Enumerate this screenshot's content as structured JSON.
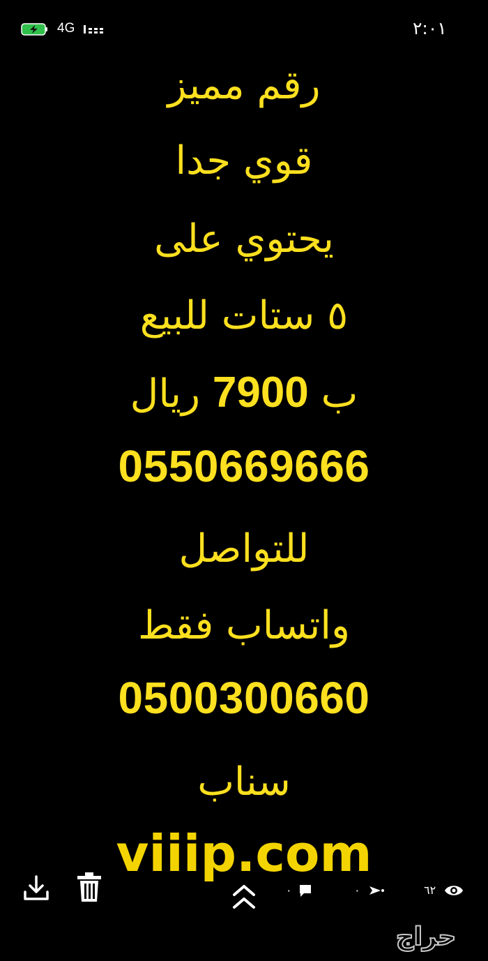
{
  "status_bar": {
    "network": "4G",
    "time": "٢:٠١"
  },
  "post_text": {
    "line1": "رقم مميز",
    "line2": "قوي جدا",
    "line3": "يحتوي على",
    "line4": "٥ ستات للبيع",
    "price_prefix": "ب",
    "price_value": "7900",
    "price_suffix": "ريال",
    "phone_number": "0550669666",
    "contact_label": "للتواصل",
    "contact_method": "واتساب فقط",
    "contact_number": "0500300660",
    "snap_label": "سناب",
    "website": "viiip.com"
  },
  "actions": {
    "views_count": "٦٢",
    "comments_count": "٠",
    "shares_count": "٠"
  },
  "brand": {
    "logo_text": "حراج"
  },
  "colors": {
    "background": "#000000",
    "text_accent": "#fde01f"
  },
  "icons": [
    "battery-charging-icon",
    "signal-icon",
    "download-icon",
    "trash-icon",
    "chevron-up-icon",
    "comment-icon",
    "share-icon",
    "eye-icon"
  ]
}
